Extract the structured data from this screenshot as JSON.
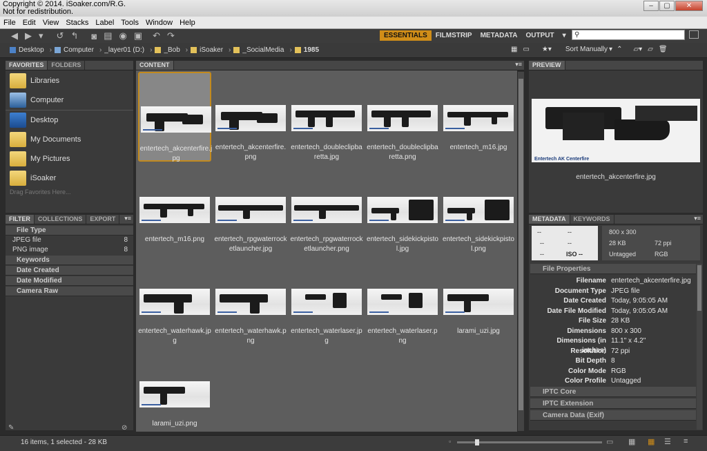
{
  "watermark": {
    "line1": "Copyright © 2014. iSoaker.com/R.G.",
    "line2": "Not for redistribution."
  },
  "menu": [
    "File",
    "Edit",
    "View",
    "Stacks",
    "Label",
    "Tools",
    "Window",
    "Help"
  ],
  "workspaces": [
    "ESSENTIALS",
    "FILMSTRIP",
    "METADATA",
    "OUTPUT"
  ],
  "search_placeholder": "",
  "path": [
    "Desktop",
    "Computer",
    "_layer01 (D:)",
    "_Bob",
    "iSoaker",
    "_SocialMedia",
    "1985"
  ],
  "sort_label": "Sort Manually",
  "left_tabs": [
    "FAVORITES",
    "FOLDERS"
  ],
  "favorites": [
    "Libraries",
    "Computer",
    "Desktop",
    "My Documents",
    "My Pictures",
    "iSoaker"
  ],
  "favorites_hint": "Drag Favorites Here...",
  "filter_tabs": [
    "FILTER",
    "COLLECTIONS",
    "EXPORT"
  ],
  "filter": {
    "file_type": "File Type",
    "types": [
      {
        "name": "JPEG file",
        "count": "8"
      },
      {
        "name": "PNG image",
        "count": "8"
      }
    ],
    "sections": [
      "Keywords",
      "Date Created",
      "Date Modified",
      "Camera Raw"
    ]
  },
  "content_tab": "CONTENT",
  "files": [
    "entertech_akcenterfire.jpg",
    "entertech_akcenterfire.png",
    "entertech_doubleclipbaretta.jpg",
    "entertech_doubleclipbaretta.png",
    "entertech_m16.jpg",
    "entertech_m16.png",
    "entertech_rpgwaterrocketlauncher.jpg",
    "entertech_rpgwaterrocketlauncher.png",
    "entertech_sidekickpistol.jpg",
    "entertech_sidekickpistol.png",
    "entertech_waterhawk.jpg",
    "entertech_waterhawk.png",
    "entertech_waterlaser.jpg",
    "entertech_waterlaser.png",
    "larami_uzi.jpg",
    "larami_uzi.png"
  ],
  "preview_tab": "PREVIEW",
  "preview_caption": "entertech_akcenterfire.jpg",
  "preview_banner": "Entertech AK Centerfire",
  "meta_tabs": [
    "METADATA",
    "KEYWORDS"
  ],
  "camera": {
    "f": "--",
    "shutter": "--",
    "a": "--",
    "b": "--",
    "c": "--",
    "iso": "ISO --"
  },
  "summary": {
    "dims": "800 x 300",
    "size": "28 KB",
    "ppi": "72 ppi",
    "tag": "Untagged",
    "mode": "RGB"
  },
  "file_props_title": "File Properties",
  "file_props": [
    {
      "k": "Filename",
      "v": "entertech_akcenterfire.jpg"
    },
    {
      "k": "Document Type",
      "v": "JPEG file"
    },
    {
      "k": "Date Created",
      "v": "Today, 9:05:05 AM"
    },
    {
      "k": "Date File Modified",
      "v": "Today, 9:05:05 AM"
    },
    {
      "k": "File Size",
      "v": "28 KB"
    },
    {
      "k": "Dimensions",
      "v": "800 x 300"
    },
    {
      "k": "Dimensions (in inches)",
      "v": "11.1\" x 4.2\""
    },
    {
      "k": "Resolution",
      "v": "72 ppi"
    },
    {
      "k": "Bit Depth",
      "v": "8"
    },
    {
      "k": "Color Mode",
      "v": "RGB"
    },
    {
      "k": "Color Profile",
      "v": "Untagged"
    }
  ],
  "meta_sections": [
    "IPTC Core",
    "IPTC Extension",
    "Camera Data (Exif)"
  ],
  "status": "16 items, 1 selected - 28 KB",
  "accent": "#d08d18"
}
